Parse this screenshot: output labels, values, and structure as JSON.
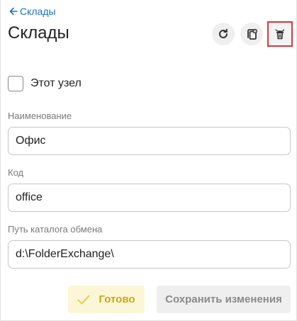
{
  "header": {
    "back_label": "Склады",
    "title": "Склады",
    "actions": [
      {
        "icon": "refresh-icon"
      },
      {
        "icon": "copy-icon"
      },
      {
        "icon": "delete-icon",
        "selected": true
      }
    ]
  },
  "form": {
    "this_node": {
      "label": "Этот узел",
      "checked": false
    },
    "name": {
      "label": "Наименование",
      "value": "Офис"
    },
    "code": {
      "label": "Код",
      "value": "office"
    },
    "exchange_path": {
      "label": "Путь каталога обмена",
      "value": "d:\\FolderExchange\\"
    }
  },
  "footer": {
    "done_label": "Готово",
    "save_label": "Сохранить изменения"
  },
  "colors": {
    "link": "#1d6fcf",
    "done_bg": "#fbf6d5",
    "done_text": "#c8a717",
    "selected_outline": "#d9363e"
  }
}
